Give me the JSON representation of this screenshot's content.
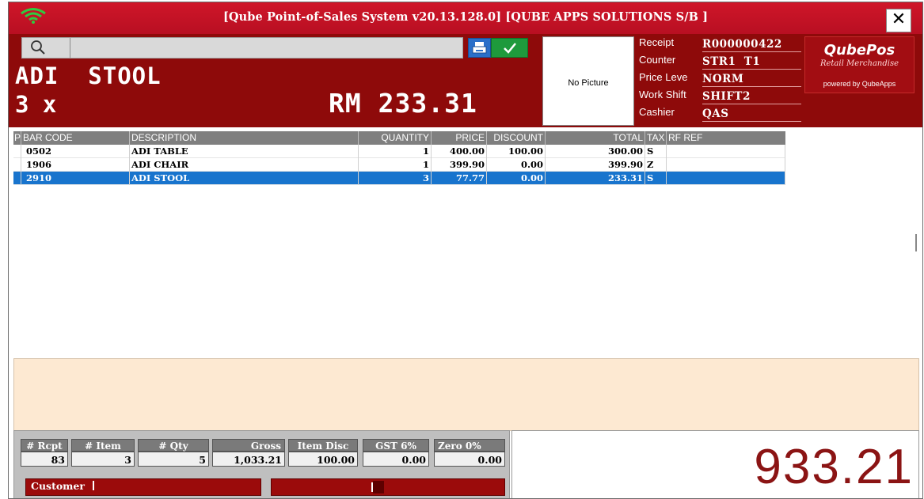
{
  "window": {
    "title": "[Qube Point-of-Sales System v20.13.128.0] [QUBE APPS SOLUTIONS S/B ]",
    "close_glyph": "✕"
  },
  "header": {
    "search": {
      "value": "",
      "placeholder": ""
    },
    "item_name": "ADI  STOOL",
    "quantity_display": "3 x",
    "price_display": "RM 233.31",
    "picture_label": "No Picture",
    "info": [
      {
        "label": "Receipt",
        "value": "R000000422"
      },
      {
        "label": "Counter",
        "value": "STR1  T1"
      },
      {
        "label": "Price Leve",
        "value": "NORM"
      },
      {
        "label": "Work Shift",
        "value": "SHIFT2"
      },
      {
        "label": "Cashier",
        "value": "QAS"
      }
    ],
    "brand": {
      "name": "QubePos",
      "tagline": "Retail Merchandise",
      "powered": "powered by QubeApps"
    }
  },
  "table": {
    "columns": [
      "P",
      "BAR CODE",
      "DESCRIPTION",
      "QUANTITY",
      "PRICE",
      "DISCOUNT",
      "TOTAL",
      "TAX",
      "RF REF"
    ],
    "rows": [
      {
        "barcode": "0502",
        "description": "ADI TABLE",
        "quantity": "1",
        "price": "400.00",
        "discount": "100.00",
        "total": "300.00",
        "tax": "S",
        "ref": ""
      },
      {
        "barcode": "1906",
        "description": "ADI CHAIR",
        "quantity": "1",
        "price": "399.90",
        "discount": "0.00",
        "total": "399.90",
        "tax": "Z",
        "ref": ""
      },
      {
        "barcode": "2910",
        "description": "ADI STOOL",
        "quantity": "3",
        "price": "77.77",
        "discount": "0.00",
        "total": "233.31",
        "tax": "S",
        "ref": ""
      }
    ],
    "selected_row": 2
  },
  "footer": {
    "stats": [
      {
        "label": "# Rcpt",
        "value": "83"
      },
      {
        "label": "# Item",
        "value": "3"
      },
      {
        "label": "# Qty",
        "value": "5"
      },
      {
        "label": "Gross",
        "value": "1,033.21"
      },
      {
        "label": "Item Disc",
        "value": "100.00"
      },
      {
        "label": "GST 6%",
        "value": "0.00"
      },
      {
        "label": "Zero 0%",
        "value": "0.00"
      }
    ],
    "customer_label": "Customer",
    "grand_total": "933.21"
  },
  "colors": {
    "title_red": "#cf1629",
    "header_maroon": "#8e0a0a",
    "selected_row": "#1874cd",
    "total_text": "#8b1414",
    "message_area": "#fde9d2"
  }
}
